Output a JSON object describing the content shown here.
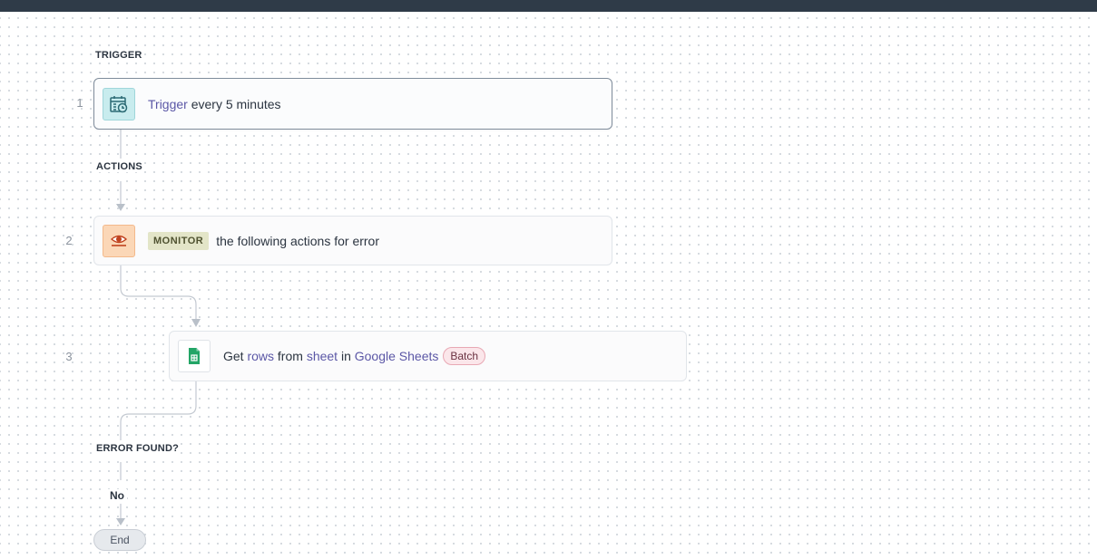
{
  "sections": {
    "trigger": "TRIGGER",
    "actions": "ACTIONS",
    "error_found": "ERROR FOUND?"
  },
  "steps": [
    {
      "number": "1",
      "icon": "calendar-clock-icon",
      "keyword": "Trigger",
      "text": " every 5 minutes"
    },
    {
      "number": "2",
      "icon": "eye-icon",
      "tag": "MONITOR",
      "text": "the following actions for error"
    },
    {
      "number": "3",
      "icon": "google-sheets-icon",
      "parts": {
        "get": "Get ",
        "rows": "rows",
        "from": " from ",
        "sheet": "sheet",
        "in": " in ",
        "app": "Google Sheets"
      },
      "badge": "Batch"
    }
  ],
  "branch_label": "No",
  "end_label": "End",
  "colors": {
    "topbar": "#2f3b48",
    "keyword": "#5b57a6",
    "monitor_tag_bg": "#e3e5c8",
    "batch_badge_bg": "#fbe6ea"
  }
}
